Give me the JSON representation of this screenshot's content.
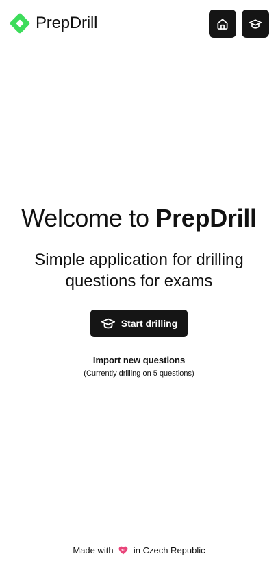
{
  "brand": {
    "name": "PrepDrill",
    "logo_icon": "diamond-logo-icon",
    "logo_color": "#3ddc5b"
  },
  "nav": {
    "home_icon": "home-icon",
    "drill_icon": "graduation-cap-icon"
  },
  "hero": {
    "welcome_prefix": "Welcome to ",
    "welcome_brand": "PrepDrill",
    "subtitle": "Simple application for drilling questions for exams",
    "start_button_label": "Start drilling",
    "start_button_icon": "graduation-cap-icon",
    "import_link": "Import new questions",
    "status": "(Currently drilling on 5 questions)"
  },
  "footer": {
    "prefix": "Made with",
    "heart_icon": "heart-icon",
    "suffix": "in Czech Republic",
    "heart_color": "#e8457a"
  },
  "colors": {
    "dark_button": "#151515",
    "background": "#ffffff",
    "text": "#111111"
  }
}
